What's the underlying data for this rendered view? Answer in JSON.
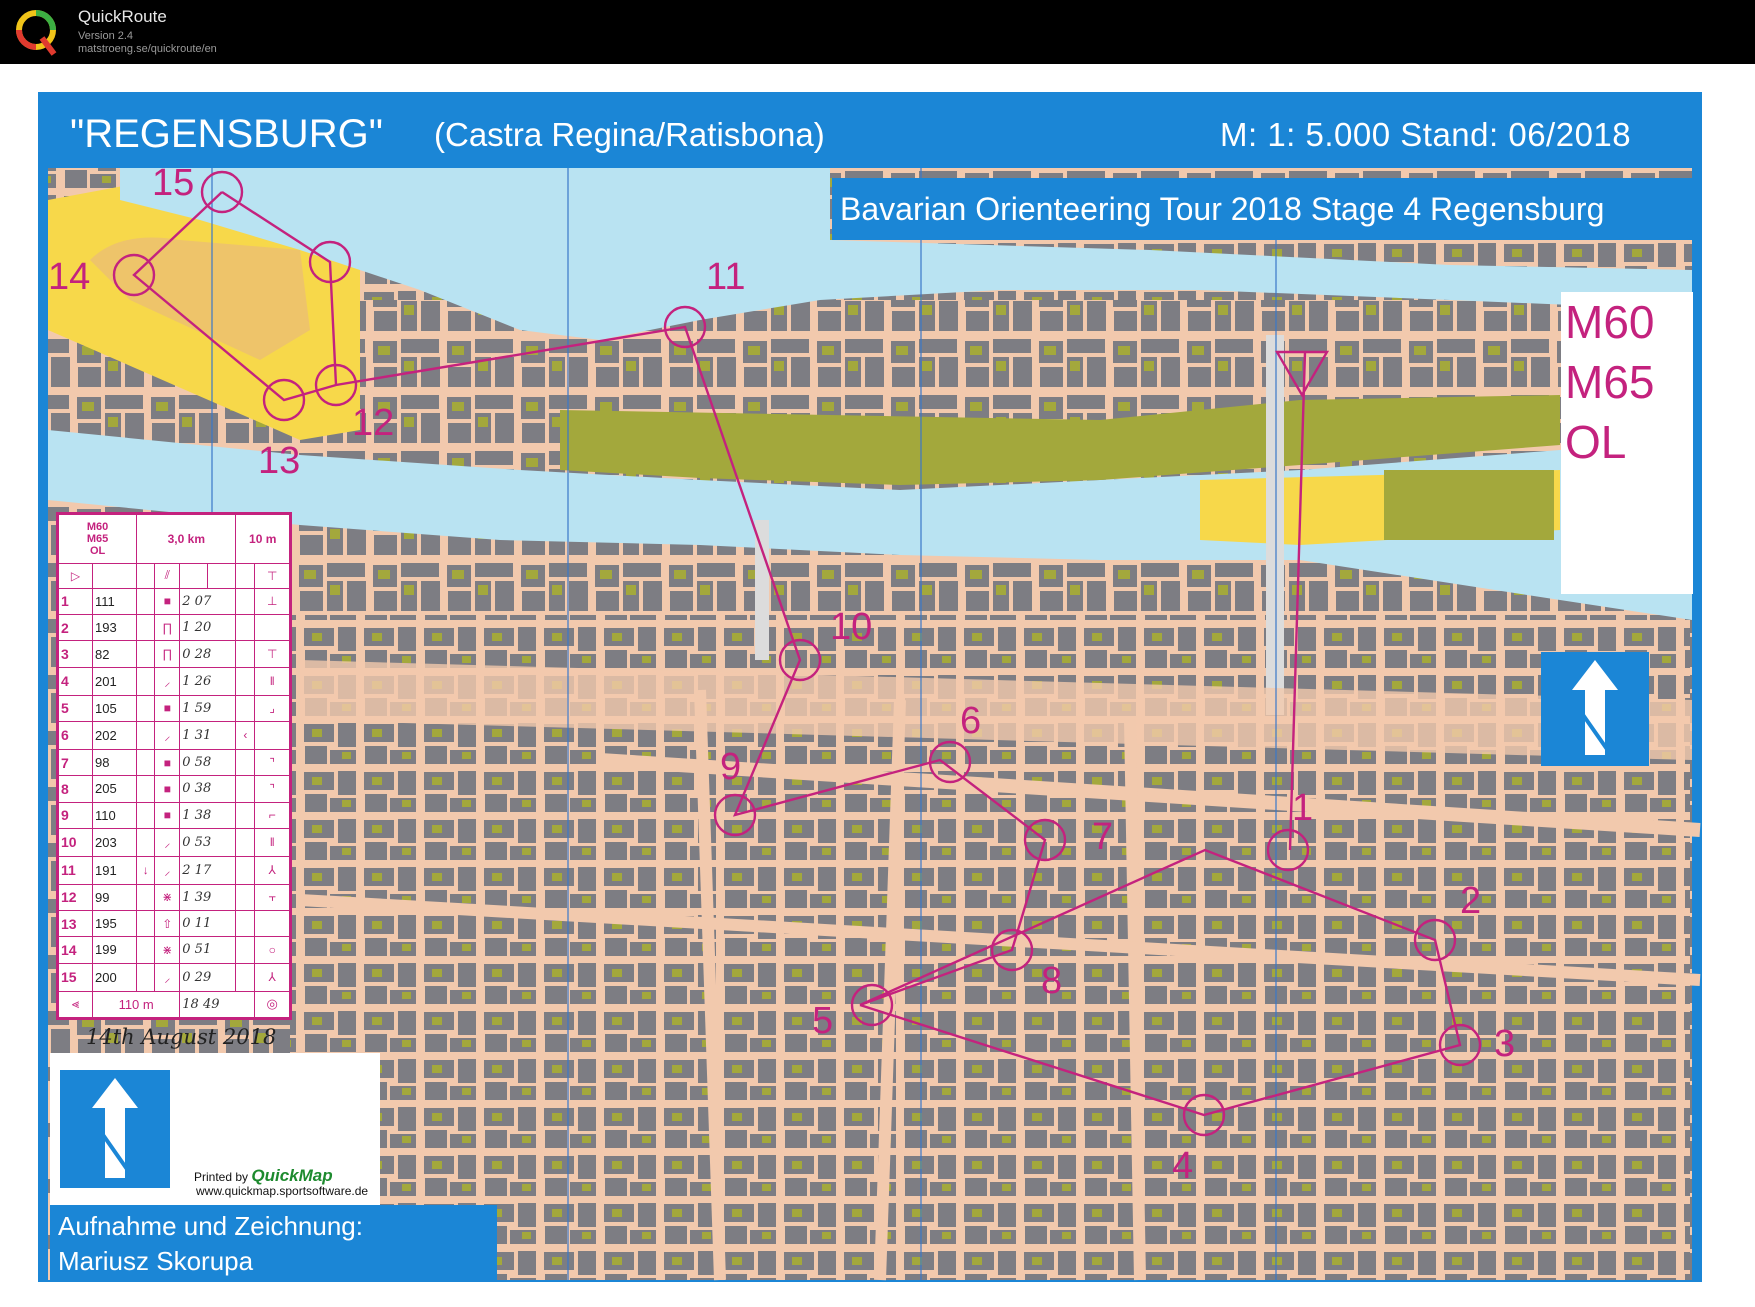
{
  "app": {
    "name": "QuickRoute",
    "version": "Version 2.4",
    "url": "matstroeng.se/quickroute/en"
  },
  "map": {
    "title": "\"REGENSBURG\"",
    "subtitle": "(Castra Regina/Ratisbona)",
    "scale_info": "M: 1: 5.000   Stand: 06/2018",
    "event": "Bavarian Orienteering Tour 2018 Stage 4 Regensburg",
    "classes": [
      "M60",
      "M65",
      "OL"
    ],
    "credit_line1": "Aufnahme und Zeichnung:",
    "credit_line2": "Mariusz Skorupa",
    "printed_by": "Printed by",
    "printed_brand": "QuickMap",
    "printed_url": "www.quickmap.sportsoftware.de",
    "handwritten_date": "14th August 2018",
    "colors": {
      "frame_blue": "#1b86d6",
      "course_magenta": "#c4227e",
      "water": "#b9e3f2",
      "street": "#f2c9ad",
      "building": "#7d7d83",
      "green": "#a3a83c",
      "open_yellow": "#f7d84a"
    }
  },
  "controls": [
    {
      "label": "15"
    },
    {
      "label": "14"
    },
    {
      "label": "13"
    },
    {
      "label": "12"
    },
    {
      "label": "11"
    },
    {
      "label": "10"
    },
    {
      "label": "9"
    },
    {
      "label": "6"
    },
    {
      "label": "7"
    },
    {
      "label": "8"
    },
    {
      "label": "5"
    },
    {
      "label": "4"
    },
    {
      "label": "3"
    },
    {
      "label": "2"
    },
    {
      "label": "1"
    }
  ],
  "description_sheet": {
    "header": {
      "classes": "M60\nM65\nOL",
      "length": "3,0 km",
      "climb": "10 m"
    },
    "rows": [
      {
        "n": "1",
        "code": "111",
        "split": "2 07"
      },
      {
        "n": "2",
        "code": "193",
        "split": "1 20"
      },
      {
        "n": "3",
        "code": "82",
        "split": "0 28"
      },
      {
        "n": "4",
        "code": "201",
        "split": "1 26"
      },
      {
        "n": "5",
        "code": "105",
        "split": "1 59"
      },
      {
        "n": "6",
        "code": "202",
        "split": "1 31"
      },
      {
        "n": "7",
        "code": "98",
        "split": "0 58"
      },
      {
        "n": "8",
        "code": "205",
        "split": "0 38"
      },
      {
        "n": "9",
        "code": "110",
        "split": "1 38"
      },
      {
        "n": "10",
        "code": "203",
        "split": "0 53"
      },
      {
        "n": "11",
        "code": "191",
        "split": "2 17"
      },
      {
        "n": "12",
        "code": "99",
        "split": "1 39"
      },
      {
        "n": "13",
        "code": "195",
        "split": "0 11"
      },
      {
        "n": "14",
        "code": "199",
        "split": "0 51"
      },
      {
        "n": "15",
        "code": "200",
        "split": "0 29"
      }
    ],
    "finish": {
      "distance": "110 m",
      "time": "18 49"
    }
  }
}
